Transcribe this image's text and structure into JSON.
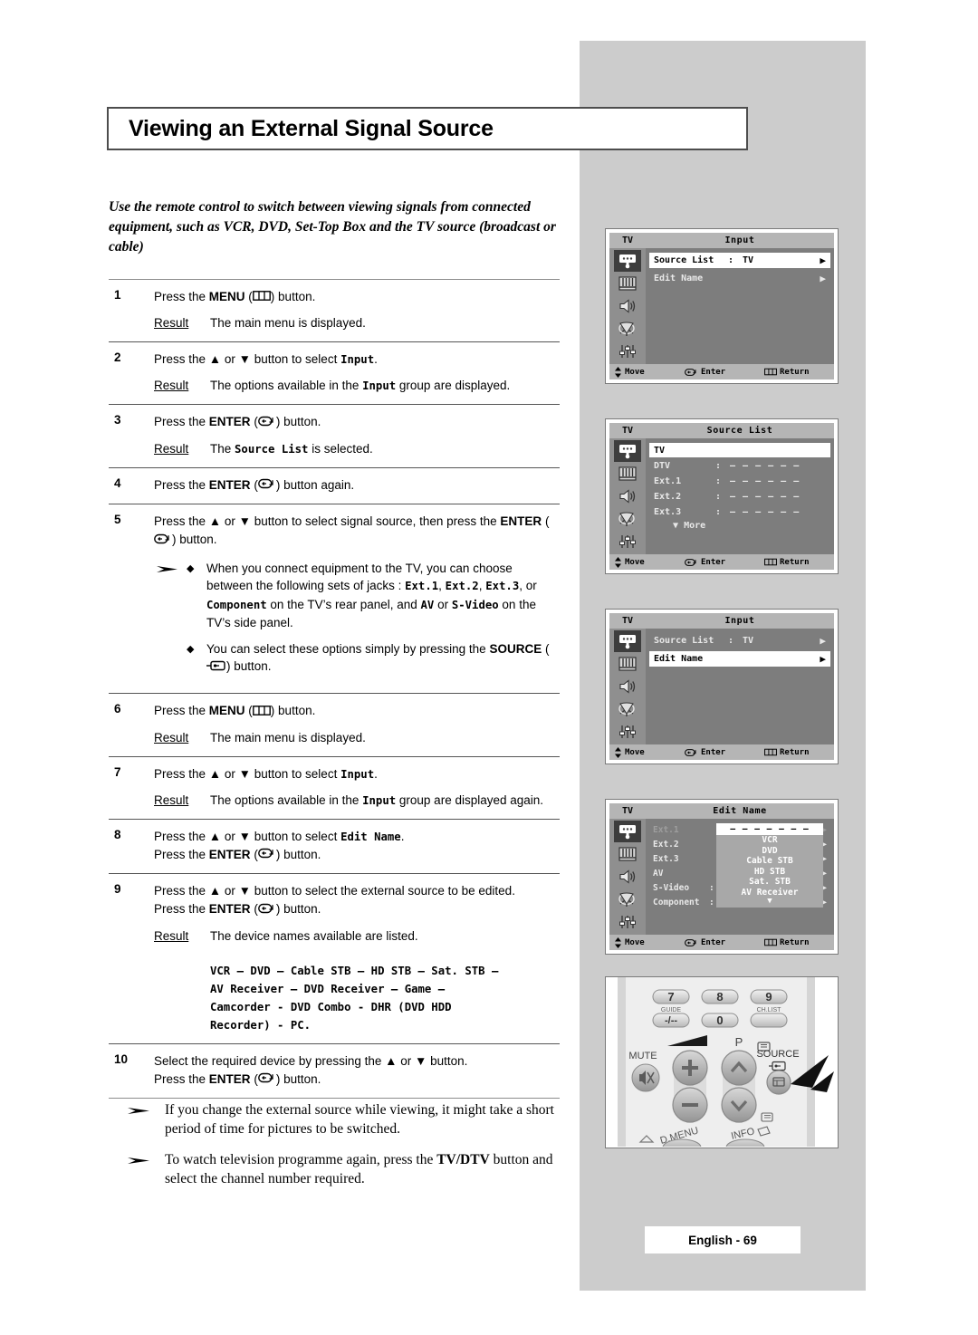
{
  "page": {
    "title": "Viewing an External Signal Source",
    "footer": "English - 69",
    "intro": "Use the remote control to switch between viewing signals from connected equipment, such as VCR, DVD, Set-Top Box and the TV source (broadcast or cable)"
  },
  "steps": [
    {
      "num": "1",
      "text_pre": "Press the ",
      "key": "MENU",
      "icon": "menu-icon",
      "text_post": " button.",
      "result_label": "Result",
      "result": "The main menu is displayed."
    },
    {
      "num": "2",
      "text_pre": "Press the ▲ or ▼ button to select ",
      "mono": "Input",
      "text_post": ".",
      "result_label": "Result",
      "result_a": "The options available in the ",
      "result_mono": "Input",
      "result_b": " group are displayed."
    },
    {
      "num": "3",
      "text_pre": "Press the ",
      "key": "ENTER",
      "icon": "enter-icon",
      "text_post": " button.",
      "result_label": "Result",
      "result_a": "The ",
      "result_mono": "Source List",
      "result_b": " is selected."
    },
    {
      "num": "4",
      "text_pre": "Press the ",
      "key": "ENTER",
      "icon": "enter-icon",
      "text_post": " button again."
    },
    {
      "num": "5",
      "text_pre": "Press the ▲ or ▼ button to select signal source, then press the ",
      "key": "ENTER",
      "icon": "enter-icon",
      "text_post": " button.",
      "bullets": [
        {
          "a": "When you connect equipment to the TV, you can choose between the following sets of jacks : ",
          "m1": "Ext.1",
          "s1": ", ",
          "m2": "Ext.2",
          "s2": ", ",
          "m3": "Ext.3",
          "s3": ", or ",
          "m4": "Component",
          "s4": " on the TV’s rear panel, and ",
          "m5": "AV",
          "s5": " or ",
          "m6": "S-Video",
          "s6": " on the TV’s side panel."
        },
        {
          "a": "You can select these options simply by pressing the ",
          "key": "SOURCE",
          "icon": "source-icon",
          "b": " button."
        }
      ]
    },
    {
      "num": "6",
      "text_pre": "Press the ",
      "key": "MENU",
      "icon": "menu-icon",
      "text_post": " button.",
      "result_label": "Result",
      "result": "The main menu is displayed."
    },
    {
      "num": "7",
      "text_pre": "Press the ▲ or ▼ button to select ",
      "mono": "Input",
      "text_post": ".",
      "result_label": "Result",
      "result_a": "The options available in the ",
      "result_mono": "Input",
      "result_b": " group are displayed again."
    },
    {
      "num": "8",
      "text_pre": "Press the ▲ or ▼ button to select ",
      "mono": "Edit Name",
      "text_post": ".",
      "line2_pre": "Press the ",
      "key": "ENTER",
      "icon": "enter-icon",
      "line2_post": " button."
    },
    {
      "num": "9",
      "text_pre": "Press the ▲ or ▼ button to select the external source to be edited.",
      "line2_pre": "Press the ",
      "key": "ENTER",
      "icon": "enter-icon",
      "line2_post": " button.",
      "result_label": "Result",
      "result": "The device names available are listed.",
      "device_lines": [
        "VCR – DVD – Cable STB – HD STB – Sat. STB –",
        "AV Receiver – DVD Receiver – Game –",
        "Camcorder - DVD Combo - DHR (DVD HDD",
        "Recorder) - PC."
      ]
    },
    {
      "num": "10",
      "text_pre": "Select the required device by pressing the ▲ or ▼ button.",
      "line2_pre": "Press the ",
      "key": "ENTER",
      "icon": "enter-icon",
      "line2_post": " button."
    }
  ],
  "notes": [
    "If you change the external source while viewing, it might take a short period of time for pictures to be switched.",
    {
      "a": "To watch television programme again, press the ",
      "key": "TV/DTV",
      "b": " button and select the channel number required."
    }
  ],
  "osd_common": {
    "tv_label": "TV",
    "sidebar_icons": [
      "input-plug-icon",
      "picture-icon",
      "sound-speaker-icon",
      "satellite-dish-icon",
      "setup-sliders-icon"
    ],
    "bottom": {
      "move": "Move",
      "enter": "Enter",
      "return": "Return"
    },
    "arrow_right": "▶"
  },
  "osd_screens": [
    {
      "name": "input-menu-source-list-selected",
      "title": "Input",
      "rows": [
        {
          "label": "Source List",
          "colon": ":",
          "value": "TV",
          "arrow": "▶",
          "highlight": true
        },
        {
          "label": "Edit Name",
          "colon": "",
          "value": "",
          "arrow": "▶",
          "highlight": false
        }
      ]
    },
    {
      "name": "source-list-menu",
      "title": "Source List",
      "rows": [
        {
          "label": "TV",
          "colon": "",
          "dashes": "",
          "highlight": true
        },
        {
          "label": "DTV",
          "colon": ":",
          "dashes": "– – – – – –",
          "highlight": false
        },
        {
          "label": "Ext.1",
          "colon": ":",
          "dashes": "– – – – – –",
          "highlight": false
        },
        {
          "label": "Ext.2",
          "colon": ":",
          "dashes": "– – – – – –",
          "highlight": false
        },
        {
          "label": "Ext.3",
          "colon": ":",
          "dashes": "– – – – – –",
          "highlight": false
        }
      ],
      "more": "More",
      "more_arrow": "▼"
    },
    {
      "name": "input-menu-edit-name-selected",
      "title": "Input",
      "rows": [
        {
          "label": "Source List",
          "colon": ":",
          "value": "TV",
          "arrow": "▶",
          "highlight": false
        },
        {
          "label": "Edit Name",
          "colon": "",
          "value": "",
          "arrow": "▶",
          "highlight": true
        }
      ]
    },
    {
      "name": "edit-name-menu",
      "title": "Edit Name",
      "rows": [
        {
          "label": "Ext.1",
          "colon": "",
          "dashes": "",
          "arrow": "▶",
          "dim": true
        },
        {
          "label": "Ext.2",
          "colon": "",
          "dashes": "",
          "arrow": "▶",
          "dim": false
        },
        {
          "label": "Ext.3",
          "colon": "",
          "dashes": "",
          "arrow": "▶",
          "dim": false
        },
        {
          "label": "AV",
          "colon": "",
          "dashes": "",
          "arrow": "▶",
          "dim": false
        },
        {
          "label": "S-Video",
          "colon": ":",
          "dashes": "– – – – – – – –",
          "arrow": "▶",
          "dim": false
        },
        {
          "label": "Component",
          "colon": ":",
          "dashes": "– – – – – – – –",
          "arrow": "▶",
          "dim": false
        }
      ],
      "dropdown": {
        "selected": "– – – – – – –",
        "items": [
          "VCR",
          "DVD",
          "Cable STB",
          "HD STB",
          "Sat. STB",
          "AV Receiver"
        ],
        "more_arrow": "▼"
      }
    }
  ],
  "remote": {
    "buttons": {
      "b7": "7",
      "b8": "8",
      "b9": "9",
      "guide": "GUIDE",
      "chlist": "CH.LIST",
      "dashdash": "-/--",
      "b0": "0",
      "mute": "MUTE",
      "p": "P",
      "source": "SOURCE",
      "dmenu": "D.MENU",
      "info": "INFO",
      "plus": "+",
      "minus": "–"
    },
    "callout": "source-button-callout-arrow"
  },
  "colors": {
    "panel_grey": "#cccccc",
    "osd_bg": "#7d7d7d",
    "osd_bar": "#b5b5b5",
    "osd_side": "#8f8f8f",
    "osd_highlight": "#ffffff",
    "dropdown_bg": "#a8a8a8",
    "rule": "#8c8c8c"
  }
}
